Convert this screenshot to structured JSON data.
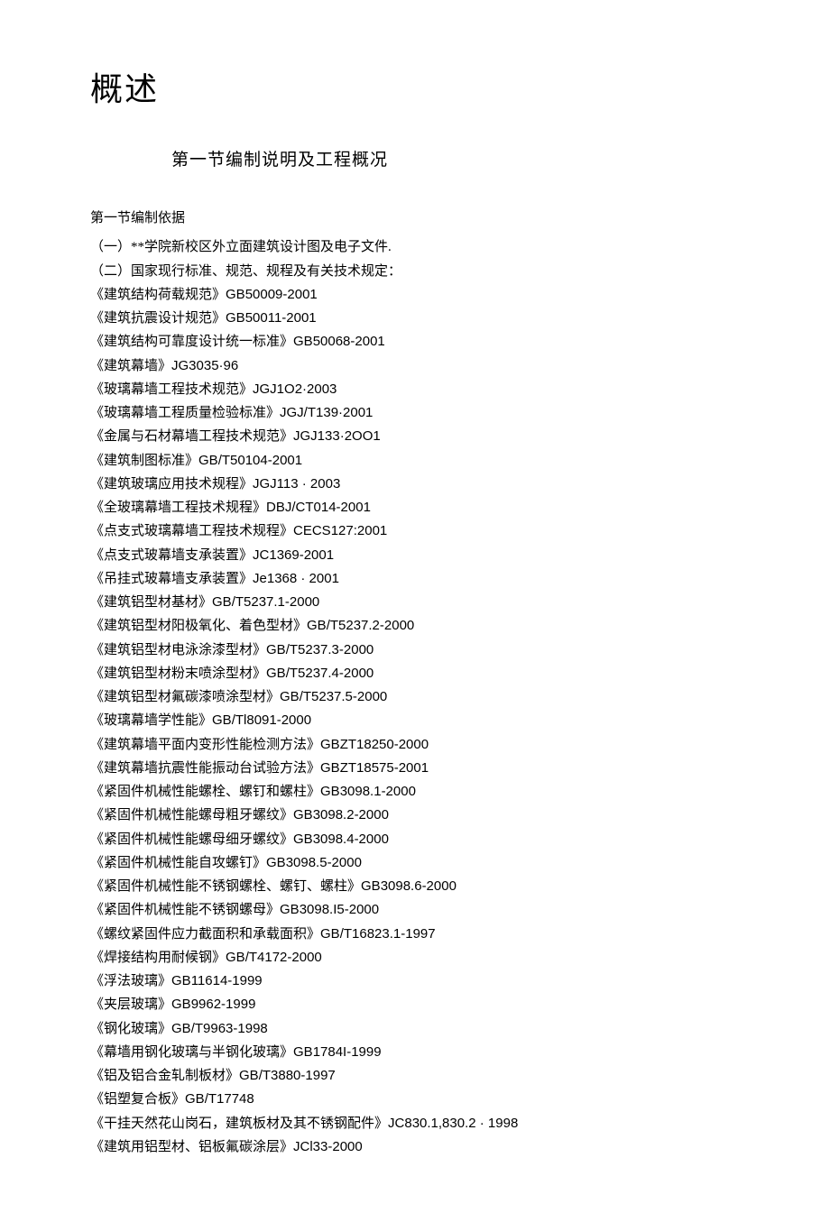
{
  "title": "概述",
  "subtitle": "第一节编制说明及工程概况",
  "sectionHeading": "第一节编制依据",
  "intro1": "（一）**学院新校区外立面建筑设计图及电子文件.",
  "intro2": "（二）国家现行标准、规范、规程及有关技术规定：",
  "standards": [
    {
      "name": "《建筑结构荷载规范》",
      "code": "GB50009-2001"
    },
    {
      "name": "《建筑抗震设计规范》",
      "code": "GB50011-2001"
    },
    {
      "name": "《建筑结构可靠度设计统一标准》",
      "code": "GB50068-2001"
    },
    {
      "name": "《建筑幕墙》",
      "code": "JG3035·96"
    },
    {
      "name": "《玻璃幕墙工程技术规范》",
      "code": "JGJ1O2·2003"
    },
    {
      "name": "《玻璃幕墙工程质量检验标准》",
      "code": "JGJ/T139·2001"
    },
    {
      "name": "《金属与石材幕墙工程技术规范》",
      "code": "JGJ133·2OO1"
    },
    {
      "name": "《建筑制图标准》",
      "code": "GB/T50104-2001"
    },
    {
      "name": "《建筑玻璃应用技术规程》",
      "code": "JGJ113 · 2003"
    },
    {
      "name": "《全玻璃幕墙工程技术规程》",
      "code": "DBJ/CT014-2001"
    },
    {
      "name": "《点支式玻璃幕墙工程技术规程》",
      "code": "CECS127:2001"
    },
    {
      "name": "《点支式玻幕墙支承装置》",
      "code": "JC1369-2001"
    },
    {
      "name": "《吊挂式玻幕墙支承装置》",
      "code": "Je1368 · 2001"
    },
    {
      "name": "《建筑铝型材基材》",
      "code": "GB/T5237.1-2000"
    },
    {
      "name": "《建筑铝型材阳极氧化、着色型材》",
      "code": "GB/T5237.2-2000"
    },
    {
      "name": "《建筑铝型材电泳涂漆型材》",
      "code": "GB/T5237.3-2000"
    },
    {
      "name": "《建筑铝型材粉末喷涂型材》",
      "code": "GB/T5237.4-2000"
    },
    {
      "name": "《建筑铝型材氟碳漆喷涂型材》",
      "code": "GB/T5237.5-2000"
    },
    {
      "name": "《玻璃幕墙学性能》",
      "code": "GB/Tl8091-2000"
    },
    {
      "name": "《建筑幕墙平面内变形性能检测方法》",
      "code": "GBZT18250-2000"
    },
    {
      "name": "《建筑幕墙抗震性能振动台试验方法》",
      "code": "GBZT18575-2001"
    },
    {
      "name": "《紧固件机械性能螺栓、螺钉和螺柱》",
      "code": "GB3098.1-2000"
    },
    {
      "name": "《紧固件机械性能螺母粗牙螺纹》",
      "code": "GB3098.2-2000"
    },
    {
      "name": "《紧固件机械性能螺母细牙螺纹》",
      "code": "GB3098.4-2000"
    },
    {
      "name": "《紧固件机械性能自攻螺钉》",
      "code": "GB3098.5-2000"
    },
    {
      "name": "《紧固件机械性能不锈钢螺栓、螺钉、螺柱》",
      "code": "GB3098.6-2000"
    },
    {
      "name": "《紧固件机械性能不锈钢螺母》",
      "code": "GB3098.I5-2000"
    },
    {
      "name": "《螺纹紧固件应力截面积和承载面积》",
      "code": "GB/T16823.1-1997"
    },
    {
      "name": "《焊接结构用耐候钢》",
      "code": "GB/T4172-2000"
    },
    {
      "name": "《浮法玻璃》",
      "code": "GB11614-1999"
    },
    {
      "name": "《夹层玻璃》",
      "code": "GB9962-1999"
    },
    {
      "name": "《钢化玻璃》",
      "code": "GB/T9963-1998"
    },
    {
      "name": "《幕墙用钢化玻璃与半钢化玻璃》",
      "code": "GB1784I-1999"
    },
    {
      "name": "《铝及铝合金轧制板材》",
      "code": "GB/T3880-1997"
    },
    {
      "name": "《铝塑复合板》",
      "code": "GB/T17748"
    },
    {
      "name": "《干挂天然花山岗石，建筑板材及其不锈钢配件》",
      "code": "JC830.1,830.2 · 1998"
    },
    {
      "name": "《建筑用铝型材、铝板氟碳涂层》",
      "code": "JCl33-2000"
    }
  ]
}
